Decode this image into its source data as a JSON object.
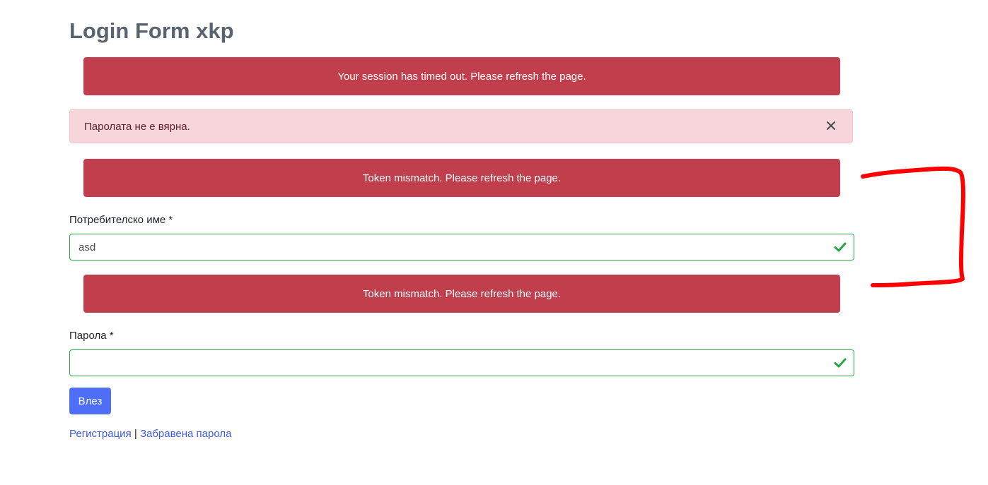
{
  "page": {
    "title": "Login Form xkp"
  },
  "toasts": {
    "session_timeout": "Your session has timed out. Please refresh the page.",
    "token_mismatch_1": "Token mismatch. Please refresh the page.",
    "token_mismatch_2": "Token mismatch. Please refresh the page."
  },
  "alert": {
    "message": "Паролата не е вярна.",
    "close_icon": "close-icon"
  },
  "form": {
    "username": {
      "label": "Потребителско име *",
      "value": "asd",
      "status_icon": "check-icon"
    },
    "password": {
      "label": "Парола *",
      "value": "",
      "status_icon": "check-icon"
    },
    "submit_label": "Влез"
  },
  "links": {
    "register": "Регистрация",
    "separator": "|",
    "forgot_password": "Забравена парола"
  },
  "colors": {
    "toast_bg": "#c13e4d",
    "alert_bg": "#f6d6da",
    "valid_border": "#28a745",
    "primary_button": "#4f6ef7",
    "link": "#3d5ce0",
    "annotation": "#ff0000"
  }
}
